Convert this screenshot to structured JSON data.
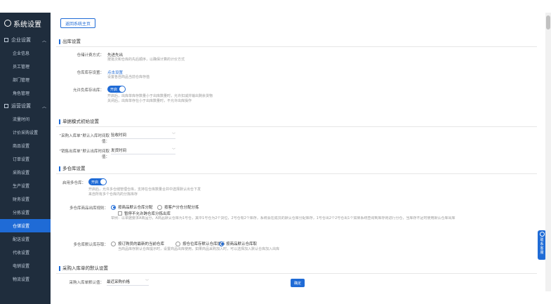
{
  "sidebar": {
    "title": "系统设置",
    "groups": [
      {
        "label": "企业设置",
        "items": [
          "企业信息",
          "员工管理",
          "部门管理",
          "角色管理"
        ]
      },
      {
        "label": "运营设置",
        "items": [
          "流量时间",
          "计价采购设置",
          "商品设置",
          "订单设置",
          "采购设置",
          "生产设置",
          "财务设置",
          "分拣设置",
          "仓储设置",
          "配送设置",
          "代收设置",
          "电销设置",
          "物流设置"
        ]
      }
    ],
    "active_item": "仓储设置"
  },
  "toolbar": {
    "back_label": "返回系统主页"
  },
  "sections": {
    "s1": {
      "title": "出库设置",
      "r1_label": "仓储计费方式：",
      "r1_value": "先进先出",
      "r1_desc": "按批次和仓库的先后顺序，以确保计算的计价方式",
      "r2_label": "仓库库存设置：",
      "r2_link": "点击设置",
      "r2_desc": "设置各自商品当前仓库存值",
      "r3_label": "允许负库存出库：",
      "r3_toggle": "开启",
      "r3_desc1": "开启后，出库单库存数量小于出库数量时，允许扣减并输出剩余货物",
      "r3_desc2": "关闭后，出库单存在小于出库数量时，不允许出库操作"
    },
    "s2": {
      "title": "单据模式初始设置",
      "r1_label": "“采购入库单”默认入库时间取值：",
      "r1_value": "验收时间",
      "r2_label": "“销售出库单”默认出库时间取值：",
      "r2_value": "发货时间"
    },
    "s3": {
      "title": "多仓库设置",
      "r1_label": "启用多仓库：",
      "r1_toggle": "开启",
      "r1_desc1": "开启后，允许多仓储管理仓库，支持在仓库数量合并中选择默认出仓下发",
      "r1_desc2": "来自所有多个仓库内的分拣库存",
      "r2_label": "多仓库商品出库规则：",
      "r2_opt1": "按商品默认仓库分配",
      "r2_opt2": "按客户分仓分配分拣",
      "r2_check": "暂停不允许跨仓库分拣出库",
      "r2_desc": "举例：以单据要求A商品分，A商品默认仓库为1号仓，其中1号仓为2个货位，2号仓有2个库存，系统会在成员的默认仓库分配库存，1号仓出2个2号仓出1个如果系统查询到库存则进行分仓，当库存不足时使用默认仓库出库",
      "r3_label": "多仓库默认库存取：",
      "r3_opt1": "按订购员的最新的当前仓库",
      "r3_opt2": "按仓位库存默认仓库提示",
      "r3_opt3": "按商品默认仓库取",
      "r3_desc": "当商品库存默认仓库提示时，设置商品出库使用，如果商品采购加入时，可以选择加入默认仓库加入出库"
    },
    "s4": {
      "title": "采购入库单的默认设置",
      "r1_label": "采购入库单默认值：",
      "r1_value": "最近采购价格"
    }
  },
  "footer": {
    "confirm_label": "确定"
  },
  "float_widget": {
    "line1": "联",
    "line2": "系",
    "line3": "客",
    "line4": "服"
  },
  "colors": {
    "accent": "#1f6bd6",
    "sidebar_bg": "#1f2d3d",
    "sidebar_text": "#bfcbd9"
  }
}
